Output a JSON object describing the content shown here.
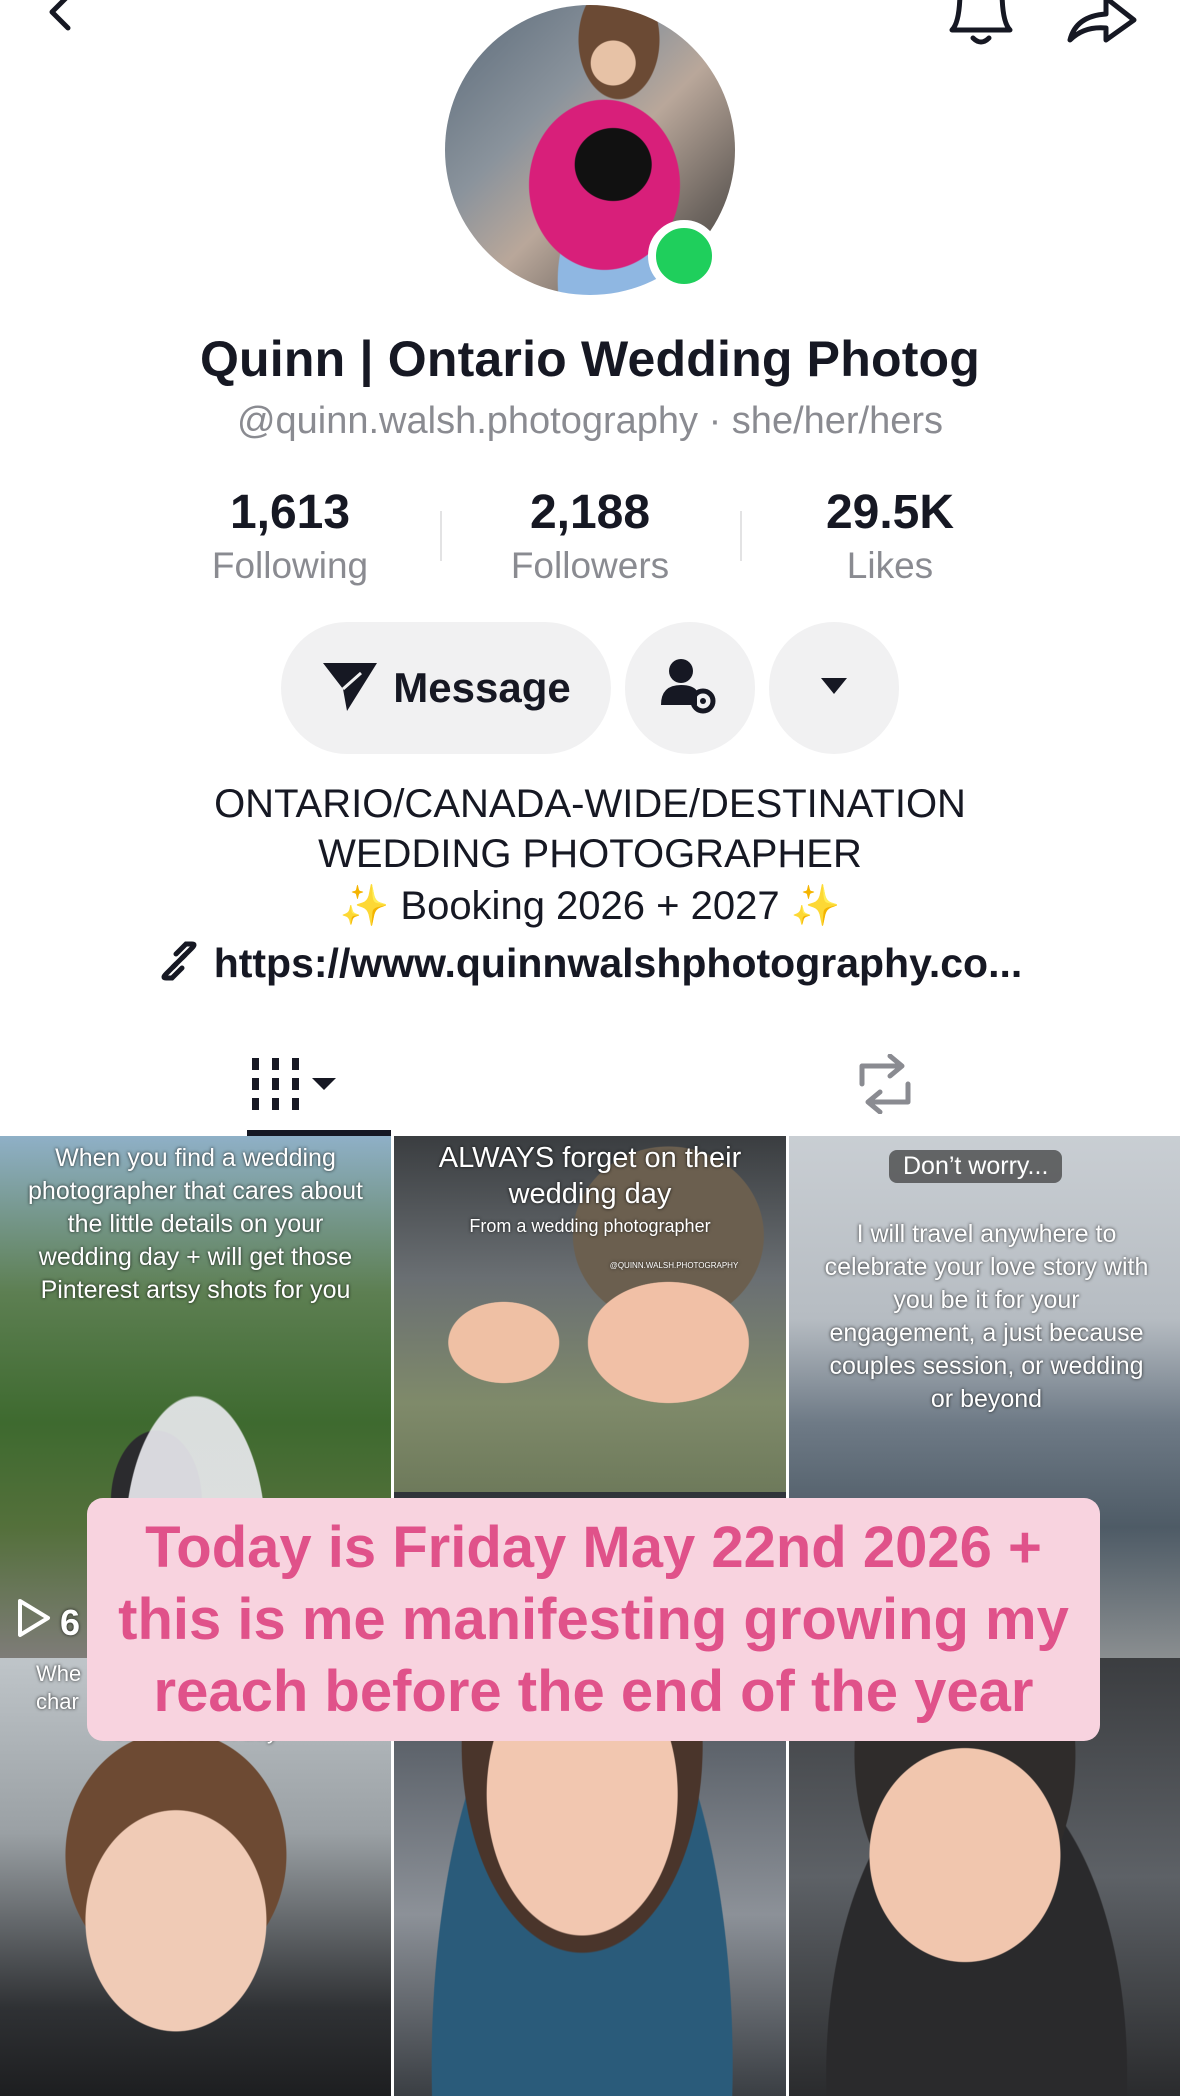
{
  "profile": {
    "name": "Quinn | Ontario Wedding Photog",
    "handle": "@quinn.walsh.photography · she/her/hers",
    "online_color": "#1fcf5c"
  },
  "top_bar": {
    "icons": [
      "back-arrow-icon",
      "bell-icon",
      "share-icon"
    ]
  },
  "stats": [
    {
      "value": "1,613",
      "label": "Following"
    },
    {
      "value": "2,188",
      "label": "Followers"
    },
    {
      "value": "29.5K",
      "label": "Likes"
    }
  ],
  "actions": {
    "message_label": "Message",
    "icons": [
      "send-icon",
      "person-settings-icon",
      "caret-down-icon"
    ]
  },
  "bio": {
    "line1": "ONTARIO/CANADA-WIDE/DESTINATION",
    "line2": "WEDDING PHOTOGRAPHER",
    "line3": "✨ Booking 2026 + 2027 ✨",
    "link": "https://www.quinnwalshphotography.co..."
  },
  "tabs": {
    "items": [
      "videos-grid-icon",
      "repost-icon"
    ],
    "active": 0
  },
  "videos": [
    {
      "caption": "When you find a wedding photographer that cares about the little details on your wedding day + will get those Pinterest artsy shots for you",
      "play_count": "6"
    },
    {
      "caption_line1": "ALWAYS forget on their",
      "caption_line2": "wedding day",
      "caption_line3": "From a wedding photographer",
      "watermark": "@QUINN.WALSH.PHOTOGRAPHY"
    },
    {
      "pill": "Don’t worry...",
      "caption": "I will travel anywhere to celebrate your love story with you be it for your engagement, a just because couples session, or wedding or beyond"
    },
    {
      "caption_line1": "Whe",
      "caption_line2": "char",
      "caption_line3": "on a session day"
    },
    {},
    {}
  ],
  "overlay": {
    "line1": "Today is Friday May 22nd 2026 +",
    "line2": "this is me manifesting growing my",
    "line3": "reach before the end of the year",
    "text_color": "#e0528a",
    "bg_color": "#f8d3df"
  }
}
